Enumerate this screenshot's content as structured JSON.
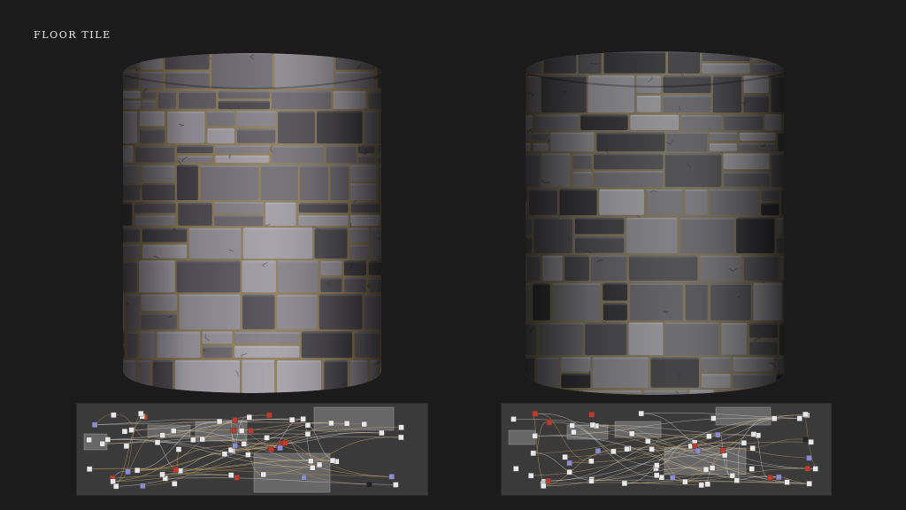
{
  "page": {
    "title": "FLOOR TILE",
    "background": "#1b1b1b"
  },
  "materials": [
    {
      "name": "left-cylinder",
      "stone_color": "#77737a",
      "stone_light": "#a6a2ab",
      "stone_dark": "#3e3c42",
      "grout_color": "#8a7a5a"
    },
    {
      "name": "right-cylinder",
      "stone_color": "#5b5a5e",
      "stone_light": "#8e8d91",
      "stone_dark": "#2a2a2d",
      "grout_color": "#6e6651"
    }
  ],
  "node_graphs": [
    {
      "name": "left-node-graph",
      "panel_color": "#3a3a3a",
      "frame_color": "#8c8c8c"
    },
    {
      "name": "right-node-graph",
      "panel_color": "#3a3a3a",
      "frame_color": "#8c8c8c"
    }
  ]
}
